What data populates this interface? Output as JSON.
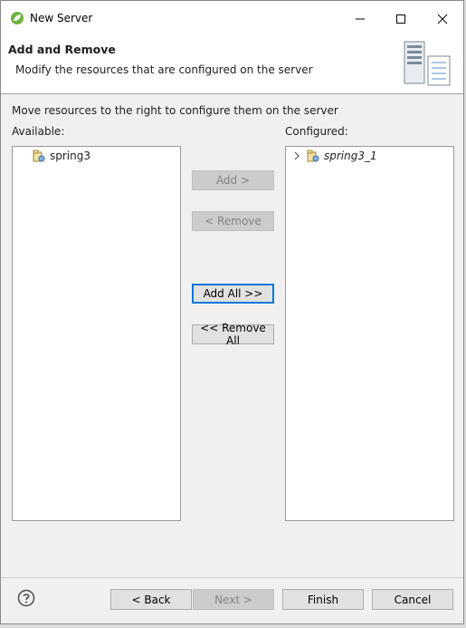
{
  "window": {
    "title": "New Server",
    "icon": "spring-leaf-icon",
    "controls": [
      "minimize-icon",
      "maximize-icon",
      "close-icon"
    ]
  },
  "header": {
    "title": "Add and Remove",
    "description": "Modify the resources that are configured on the server",
    "image": "server-list-icon"
  },
  "main": {
    "instruction": "Move resources to the right to configure them on the server",
    "available_label": "Available:",
    "configured_label": "Configured:",
    "available_items": [
      {
        "label": "spring3",
        "icon": "web-project-icon"
      }
    ],
    "configured_items": [
      {
        "label": "spring3_1",
        "icon": "web-project-icon",
        "expandable": true,
        "italic": true
      }
    ],
    "buttons": {
      "add": "Add >",
      "remove": "< Remove",
      "add_all": "Add All >>",
      "remove_all": "<< Remove All"
    }
  },
  "footer": {
    "help_icon": "help-icon",
    "back": "< Back",
    "next": "Next >",
    "finish": "Finish",
    "cancel": "Cancel"
  },
  "colors": {
    "focus_border": "#0078d7",
    "disabled_bg": "#cccccc",
    "disabled_text": "#838383"
  }
}
